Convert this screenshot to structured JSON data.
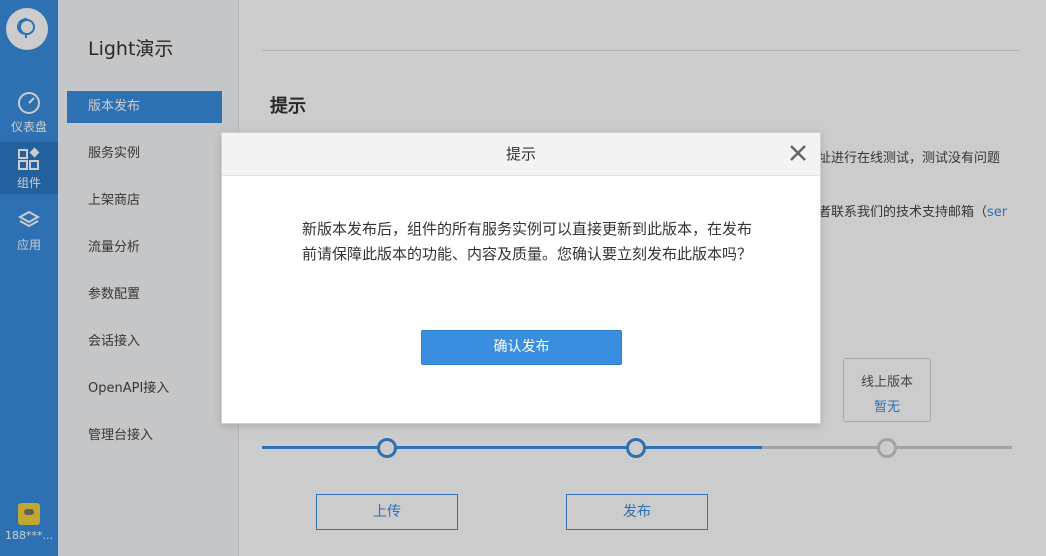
{
  "rail": {
    "items": [
      {
        "label": "仪表盘",
        "icon": "dashboard-icon"
      },
      {
        "label": "组件",
        "icon": "components-icon"
      },
      {
        "label": "应用",
        "icon": "app-icon"
      }
    ],
    "user": "188***..."
  },
  "menu": {
    "title": "Light演示",
    "items": [
      "版本发布",
      "服务实例",
      "上架商店",
      "流量分析",
      "参数配置",
      "会话接入",
      "OpenAPI接入",
      "管理台接入"
    ]
  },
  "main": {
    "tip_title": "提示",
    "tip_line1_tail": "址进行在线测试，测试没有问题",
    "tip_line2_tail": "者联系我们的技术支持邮箱（",
    "tip_line2_link": "ser",
    "online_version_label": "线上版本",
    "online_version_value": "暂无",
    "upload_label": "上传",
    "publish_label": "发布"
  },
  "modal": {
    "title": "提示",
    "body": "新版本发布后，组件的所有服务实例可以直接更新到此版本，在发布前请保障此版本的功能、内容及质量。您确认要立刻发布此版本吗？",
    "confirm_label": "确认发布"
  },
  "colors": {
    "accent": "#3a8ee0",
    "rail": "#3a8ee0",
    "track_inactive": "#c8ccd0"
  }
}
